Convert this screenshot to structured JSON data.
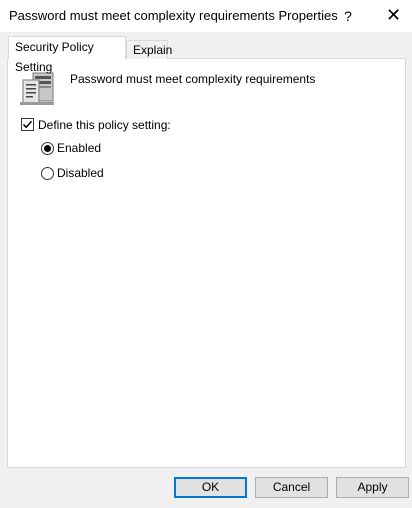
{
  "window": {
    "title": "Password must meet complexity requirements Properties",
    "help_label": "?",
    "close_label": "✕"
  },
  "tabs": [
    {
      "label": "Security Policy Setting",
      "active": true
    },
    {
      "label": "Explain",
      "active": false
    }
  ],
  "policy": {
    "icon": "server-policy-icon",
    "name": "Password must meet complexity requirements"
  },
  "define_setting": {
    "label": "Define this policy setting:",
    "checked": true
  },
  "options": [
    {
      "label": "Enabled",
      "selected": true
    },
    {
      "label": "Disabled",
      "selected": false
    }
  ],
  "buttons": {
    "ok": "OK",
    "cancel": "Cancel",
    "apply": "Apply"
  },
  "colors": {
    "focus_border": "#0078d7",
    "window_bg": "#f0f0f0"
  }
}
